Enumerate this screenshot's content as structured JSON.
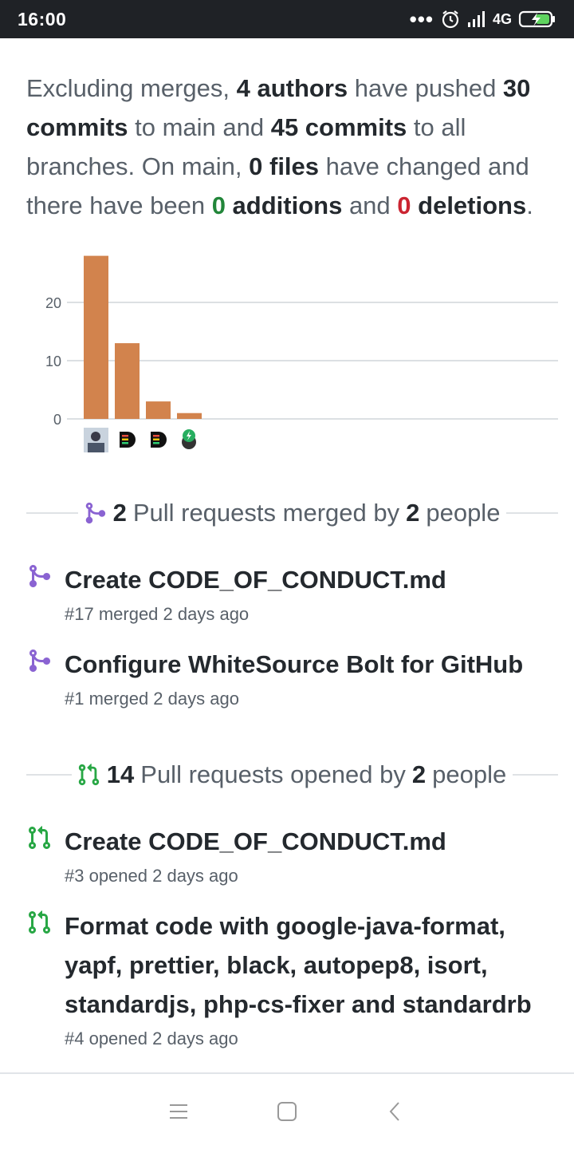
{
  "status": {
    "time": "16:00",
    "network": "4G"
  },
  "summary": {
    "p1": "Excluding merges, ",
    "authors": "4 authors",
    "p2": " have pushed ",
    "commits_main": "30 commits",
    "p3": " to main and ",
    "commits_all": "45 commits",
    "p4": " to all branches. On main, ",
    "files": "0 files",
    "p5": " have changed and there have been ",
    "additions_num": "0",
    "additions_word": " additions",
    "p6": " and ",
    "deletions_num": "0",
    "deletions_word": " deletions",
    "p7": "."
  },
  "chart_data": {
    "type": "bar",
    "categories": [
      "author-photo",
      "author-bot-1",
      "author-bot-2",
      "author-whitesource"
    ],
    "values": [
      28,
      13,
      3,
      1
    ],
    "ylim": [
      0,
      28
    ],
    "yticks": [
      "0",
      "10",
      "20"
    ],
    "grid": true,
    "bar_color": "#d2834d"
  },
  "merged_section": {
    "count": "2",
    "text": "Pull requests merged by",
    "people": "2",
    "people_word": "people"
  },
  "merged_prs": [
    {
      "title": "Create CODE_OF_CONDUCT.md",
      "meta": "#17 merged 2 days ago"
    },
    {
      "title": "Configure WhiteSource Bolt for GitHub",
      "meta": "#1 merged 2 days ago"
    }
  ],
  "opened_section": {
    "count": "14",
    "text": "Pull requests opened by",
    "people": "2",
    "people_word": "people"
  },
  "opened_prs": [
    {
      "title": "Create CODE_OF_CONDUCT.md",
      "meta": "#3 opened 2 days ago"
    },
    {
      "title": "Format code with google-java-format, yapf, prettier, black, autopep8, isort, standardjs, php-cs-fixer and standardrb",
      "meta": "#4 opened 2 days ago"
    }
  ],
  "colors": {
    "merged": "#8a63d2",
    "opened": "#28a745",
    "additions": "#22863a",
    "deletions": "#cb2431"
  },
  "icons": {
    "merged_pr": "git-merge-icon",
    "opened_pr": "git-pull-request-icon",
    "nav_menu": "menu-icon",
    "nav_home": "home-square-icon",
    "nav_back": "back-chevron-icon"
  }
}
